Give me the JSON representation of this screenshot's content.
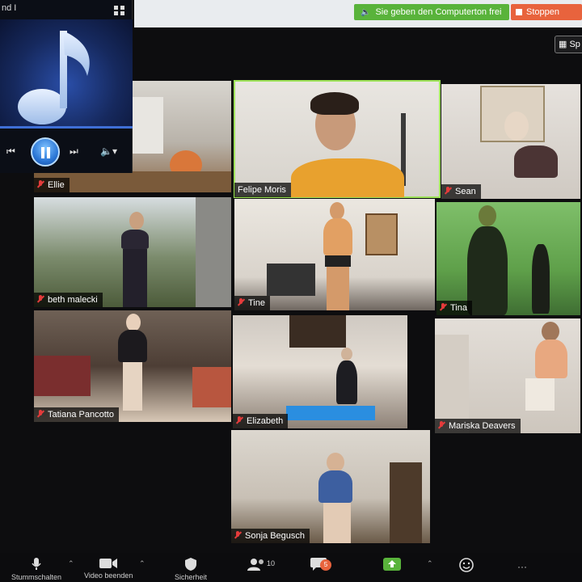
{
  "player": {
    "title": "nd I",
    "art_icon": "music-note-icon",
    "controls": [
      "previous-icon",
      "pause-icon",
      "next-icon",
      "volume-icon"
    ]
  },
  "topbar": {
    "audio_notice": "Sie geben den Computerton frei",
    "stop_label": "Stoppen"
  },
  "speaker_view_label": "Sp",
  "participants": [
    {
      "name": "Ellie"
    },
    {
      "name": "Felipe Moris"
    },
    {
      "name": "Sean"
    },
    {
      "name": "beth malecki"
    },
    {
      "name": "Tine"
    },
    {
      "name": "Tina"
    },
    {
      "name": "Tatiana Pancotto"
    },
    {
      "name": "Elizabeth"
    },
    {
      "name": "Mariska Deavers"
    },
    {
      "name": "Sonja Begusch"
    }
  ],
  "toolbar": {
    "mute_label": "Stummschalten",
    "video_label": "Video beenden",
    "security_label": "Sicherheit",
    "participants_count": "10",
    "chat_badge": "5"
  },
  "colors": {
    "active_speaker_border": "#9ee25a",
    "audio_share_green": "#59b33b",
    "stop_orange": "#e8633d",
    "muted_red": "#e43b3b"
  }
}
